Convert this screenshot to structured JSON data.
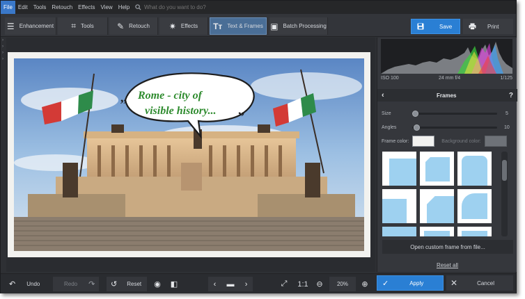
{
  "menu": {
    "items": [
      "File",
      "Edit",
      "Tools",
      "Retouch",
      "Effects",
      "View",
      "Help"
    ],
    "search_placeholder": "What do you want to do?"
  },
  "toolbar": {
    "tabs": [
      {
        "label": "Enhancement",
        "icon": "sliders-icon"
      },
      {
        "label": "Tools",
        "icon": "crop-icon"
      },
      {
        "label": "Retouch",
        "icon": "brush-icon"
      },
      {
        "label": "Effects",
        "icon": "sparkle-icon"
      },
      {
        "label": "Text & Frames",
        "icon": "text-icon"
      },
      {
        "label": "Batch Processing",
        "icon": "batch-icon"
      }
    ],
    "active_tab": "Text & Frames",
    "save_label": "Save",
    "print_label": "Print"
  },
  "photo": {
    "caption_line1": "Rome - city of",
    "caption_line2": "visible history...",
    "caption_color": "#2e8b2e"
  },
  "info": {
    "iso": "ISO 100",
    "lens": "24 mm f/4",
    "shutter": "1/125"
  },
  "frames_panel": {
    "title": "Frames",
    "size_label": "Size",
    "size_value": "5",
    "angles_label": "Angles",
    "angles_value": "10",
    "frame_color_label": "Frame color:",
    "background_color_label": "Background color:",
    "open_custom_label": "Open custom frame from file...",
    "reset_all_label": "Reset all",
    "frame_color": "#f2f2f0"
  },
  "bottom": {
    "undo_label": "Undo",
    "redo_label": "Redo",
    "reset_label": "Reset",
    "ratio_label": "1:1",
    "zoom_value": "20%",
    "apply_label": "Apply",
    "cancel_label": "Cancel"
  },
  "colors": {
    "accent": "#2a7fd4",
    "panel": "#35373c",
    "active_tab": "#4a6e96"
  }
}
